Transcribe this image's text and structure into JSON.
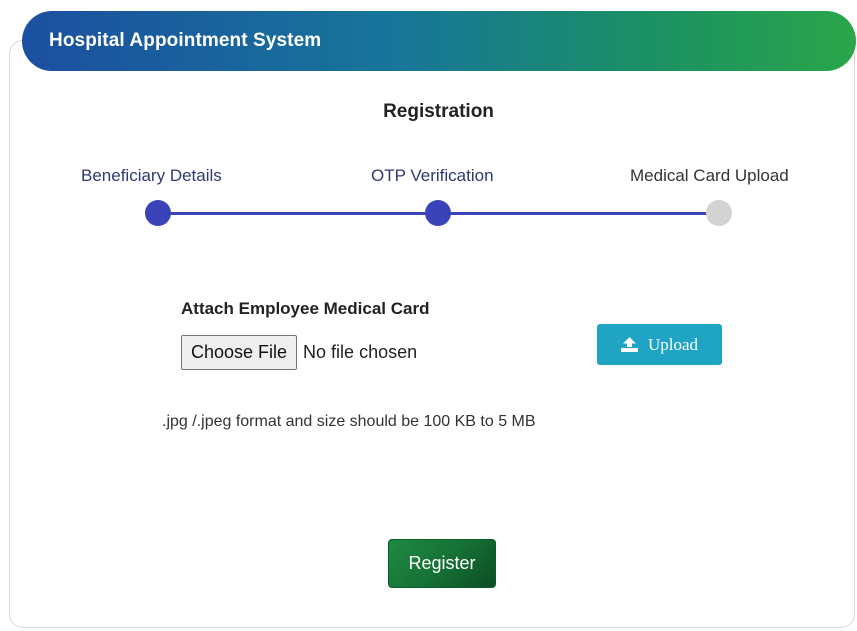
{
  "header": {
    "title": "Hospital Appointment System"
  },
  "registration": {
    "title": "Registration"
  },
  "steps": [
    {
      "label": "Beneficiary Details",
      "status": "complete"
    },
    {
      "label": "OTP Verification",
      "status": "complete"
    },
    {
      "label": "Medical Card Upload",
      "status": "pending"
    }
  ],
  "upload_section": {
    "label": "Attach Employee Medical Card",
    "choose_file_label": "Choose File",
    "file_status": "No file chosen",
    "upload_label": "Upload",
    "hint": ".jpg /.jpeg format and size should be 100 KB to 5 MB"
  },
  "actions": {
    "register_label": "Register"
  },
  "colors": {
    "header_gradient": [
      "#1c4fa0",
      "#2aa64a"
    ],
    "step_active": "#3a43b8",
    "step_inactive": "#d3d3d3",
    "upload_button": "#20a4c3",
    "register_button": "#167235"
  },
  "icons": {
    "upload": "upload-icon"
  }
}
